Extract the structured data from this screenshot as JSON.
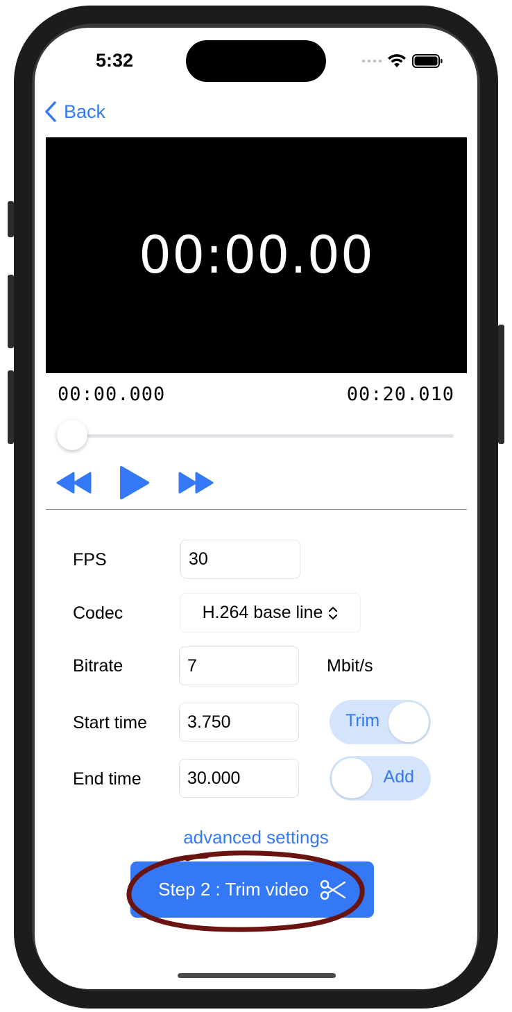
{
  "status_bar": {
    "time": "5:32"
  },
  "nav": {
    "back_label": "Back"
  },
  "player": {
    "overlay_time": "00:00.00",
    "current_time": "00:00.000",
    "total_time": "00:20.010",
    "progress": 0.0
  },
  "settings": {
    "fps": {
      "label": "FPS",
      "value": "30"
    },
    "codec": {
      "label": "Codec",
      "value": "H.264 base line"
    },
    "bitrate": {
      "label": "Bitrate",
      "value": "7",
      "unit": "Mbit/s"
    },
    "start_time": {
      "label": "Start time",
      "value": "3.750",
      "toggle_label": "Trim",
      "toggle_on": true
    },
    "end_time": {
      "label": "End time",
      "value": "30.000",
      "toggle_label": "Add",
      "toggle_on": false
    }
  },
  "advanced_link": "advanced settings",
  "action_button": {
    "label": "Step 2 : Trim video"
  },
  "colors": {
    "accent": "#3478f6",
    "toggle_bg": "#d4e4fc",
    "annotation": "#6a1411"
  }
}
